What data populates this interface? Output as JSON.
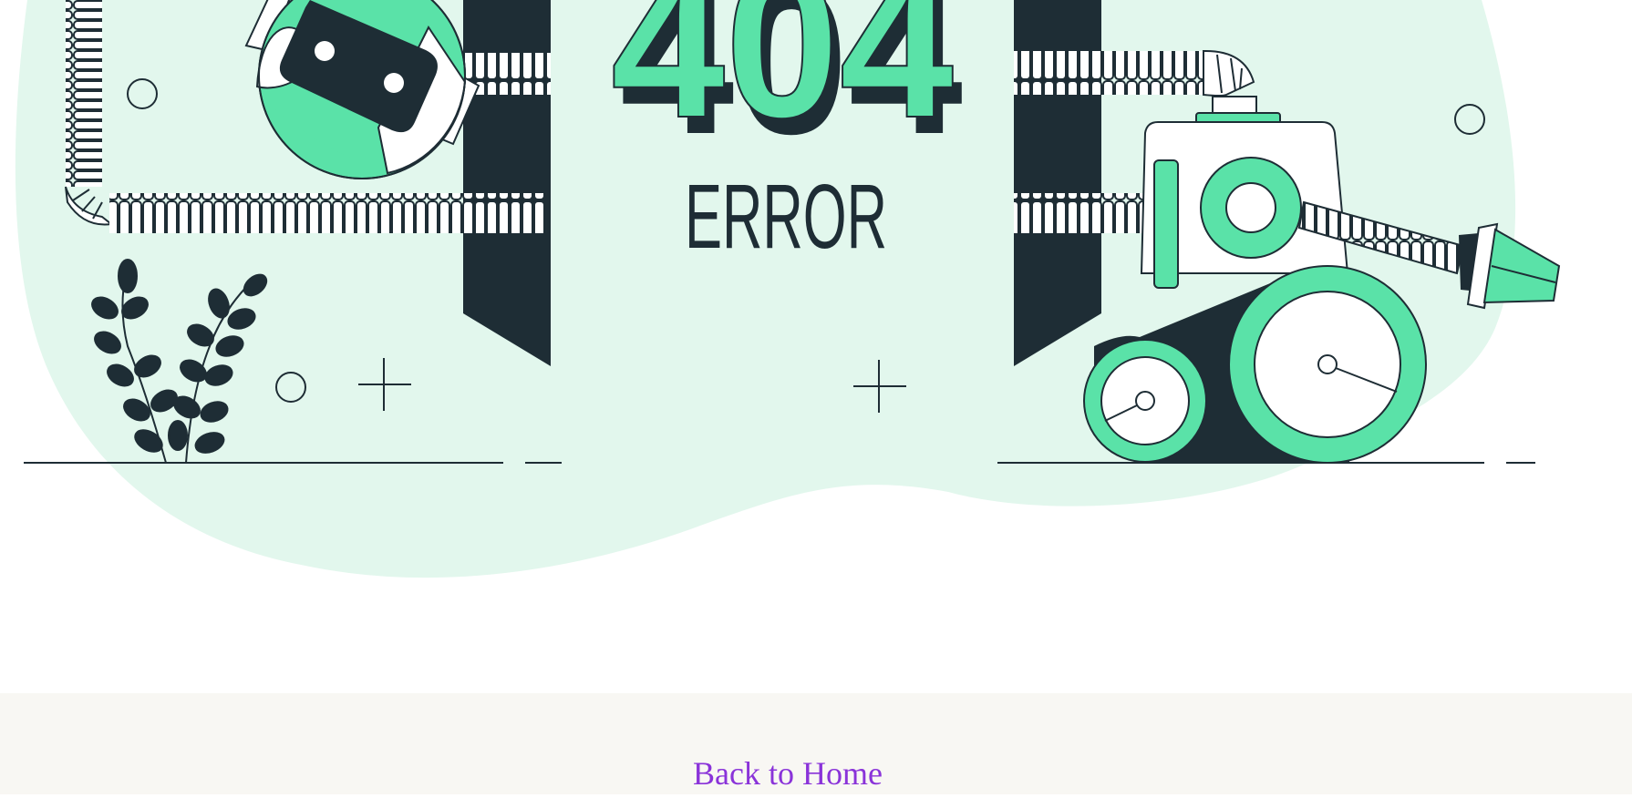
{
  "hero": {
    "code": "404",
    "label": "ERROR"
  },
  "footer": {
    "back_link_label": "Back to Home"
  },
  "colors": {
    "accent_green": "#5ae2a8",
    "blob_bg": "#e2f7ed",
    "dark": "#1e2d35",
    "link": "#8a33d9",
    "footer_bg": "#f8f7f3"
  }
}
